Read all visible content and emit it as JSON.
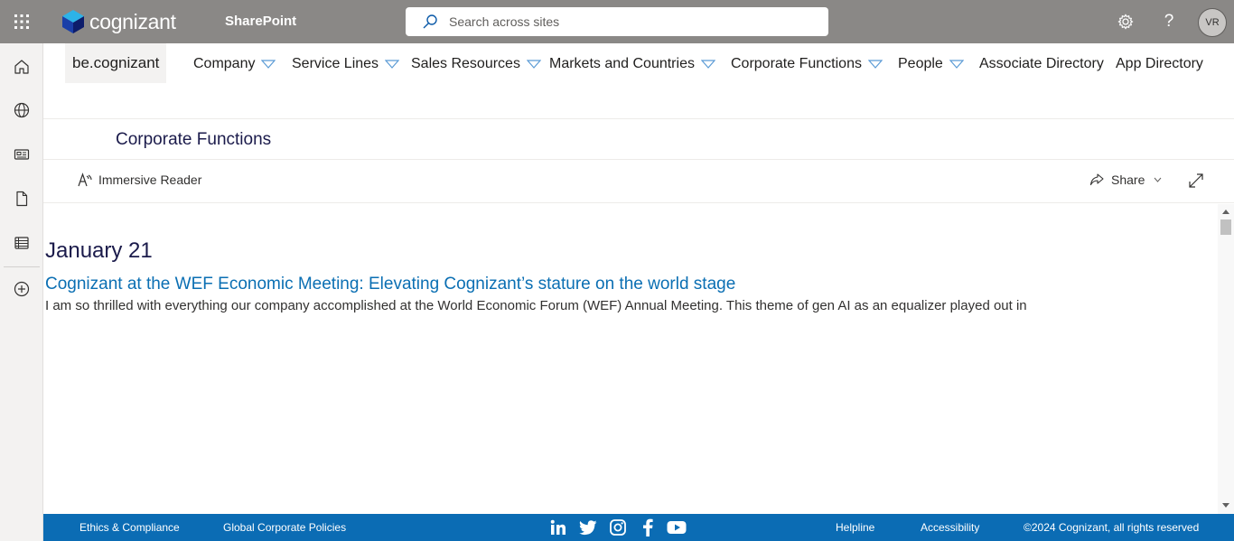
{
  "suite": {
    "brand": "cognizant",
    "app_name": "SharePoint",
    "search_placeholder": "Search across sites",
    "avatar_initials": "VR",
    "help_glyph": "?"
  },
  "appbar": {
    "icons": [
      "home-icon",
      "globe-icon",
      "news-icon",
      "file-icon",
      "list-icon",
      "add-icon"
    ]
  },
  "hub": {
    "site_title": "be.cognizant",
    "nav": [
      {
        "label": "Company",
        "has_dropdown": true
      },
      {
        "label": "Service Lines",
        "has_dropdown": true
      },
      {
        "label": "Sales Resources",
        "has_dropdown": true
      },
      {
        "label": "Markets and Countries",
        "has_dropdown": true
      },
      {
        "label": "Corporate Functions",
        "has_dropdown": true
      },
      {
        "label": "People",
        "has_dropdown": true
      },
      {
        "label": "Associate Directory",
        "has_dropdown": false
      },
      {
        "label": "App Directory",
        "has_dropdown": false
      }
    ]
  },
  "page": {
    "title": "Corporate Functions",
    "immersive_reader": "Immersive Reader",
    "share": "Share"
  },
  "content": {
    "date": "January 21",
    "headline": "Cognizant at the WEF Economic Meeting: Elevating Cognizant’s stature on the world stage",
    "body": "I am so thrilled with everything our company accomplished at the World Economic Forum (WEF) Annual Meeting. This theme of gen AI as an equalizer played out in"
  },
  "footer": {
    "links_left": [
      "Ethics & Compliance",
      "Global Corporate Policies"
    ],
    "social": [
      "linkedin-icon",
      "twitter-icon",
      "instagram-icon",
      "facebook-icon",
      "youtube-icon"
    ],
    "links_right": [
      "Helpline",
      "Accessibility"
    ],
    "copyright": "©2024 Cognizant, all rights reserved"
  },
  "colors": {
    "suite_bar": "#8a8886",
    "footer": "#0b6cb4",
    "headline_link": "#0b6fb3",
    "title_navy": "#1b1b4b"
  }
}
